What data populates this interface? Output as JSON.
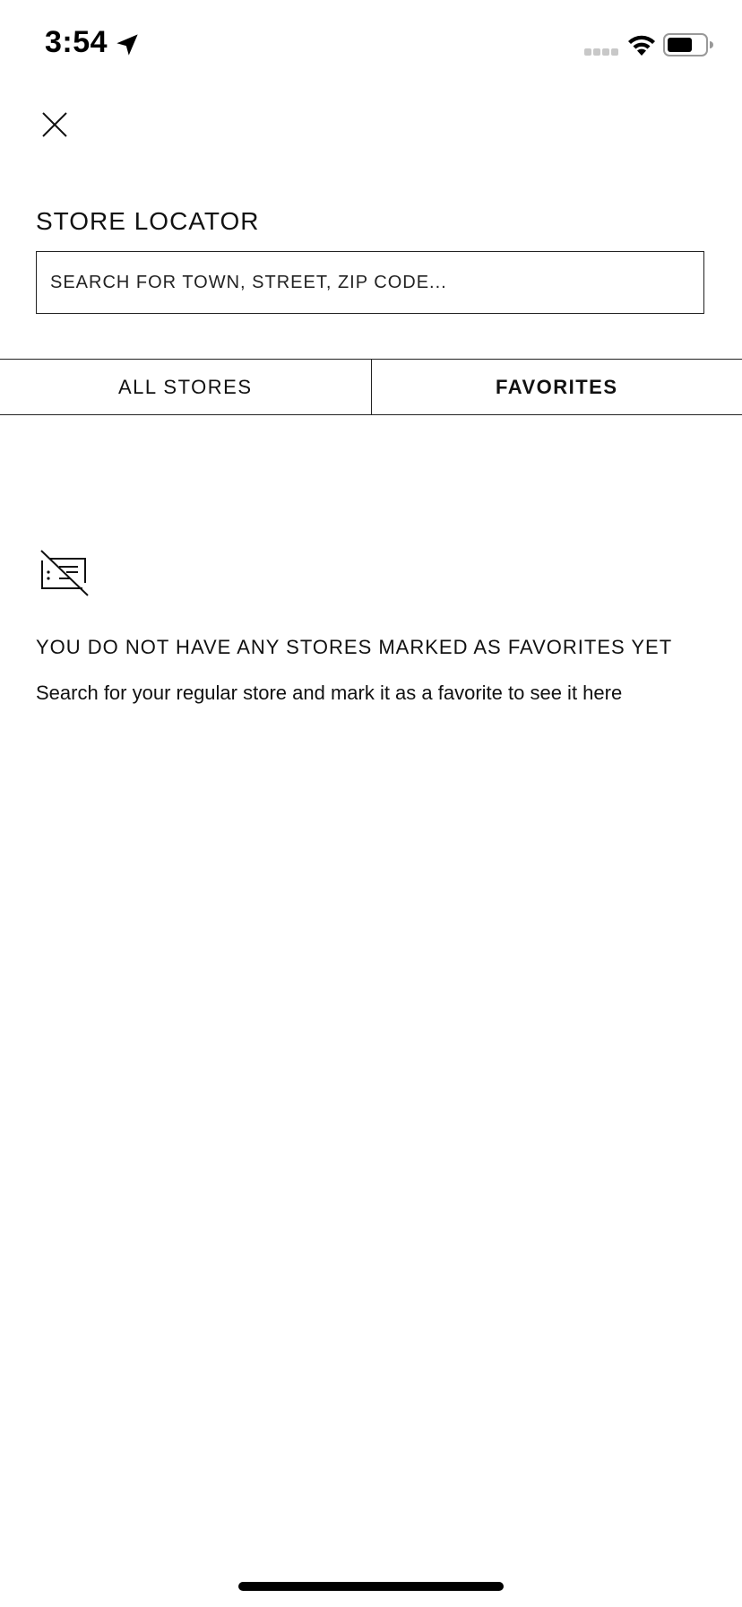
{
  "status_bar": {
    "time": "3:54",
    "icons": [
      "location-arrow-icon",
      "signal-icon",
      "wifi-icon",
      "battery-icon"
    ]
  },
  "header": {
    "close_icon": "close-icon",
    "title": "STORE LOCATOR"
  },
  "search": {
    "placeholder": "SEARCH FOR TOWN, STREET, ZIP CODE...",
    "value": ""
  },
  "tabs": [
    {
      "label": "ALL STORES",
      "active": false
    },
    {
      "label": "FAVORITES",
      "active": true
    }
  ],
  "empty_state": {
    "icon": "no-favorites-list-icon",
    "title": "YOU DO NOT HAVE ANY STORES MARKED AS FAVORITES YET",
    "description": "Search for your regular store and mark it as a favorite to see it here"
  },
  "colors": {
    "background": "#ffffff",
    "text": "#111111",
    "border": "#222222"
  }
}
